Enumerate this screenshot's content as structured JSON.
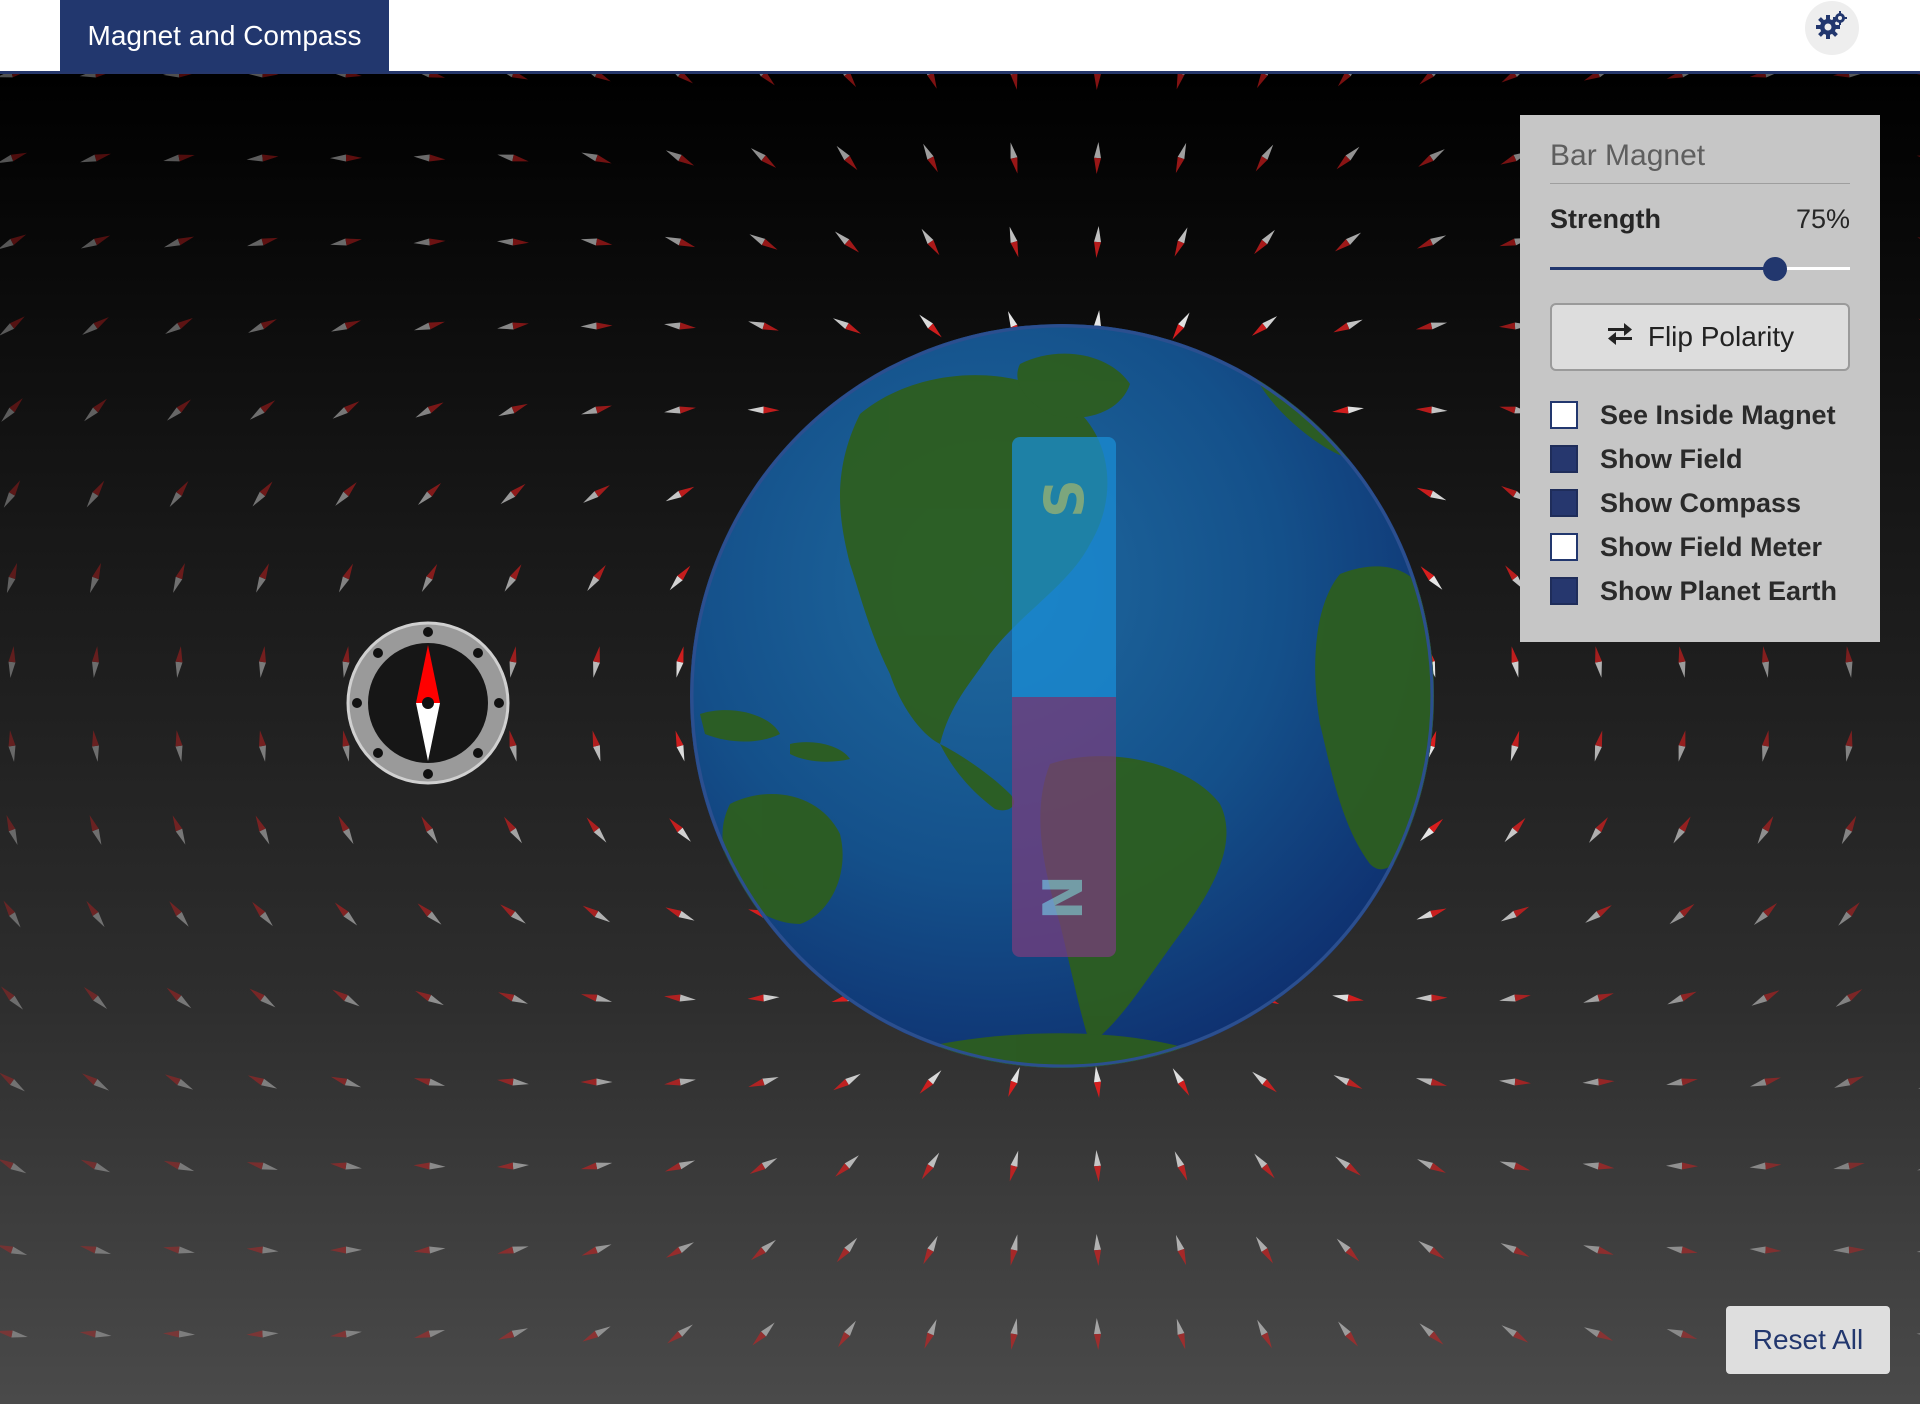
{
  "header": {
    "app_title": "Magnet and Compass",
    "settings_icon": "gears-icon"
  },
  "magnet": {
    "south_label": "S",
    "north_label": "N"
  },
  "panel": {
    "title": "Bar Magnet",
    "strength_label": "Strength",
    "strength_value_text": "75%",
    "strength_fraction": 0.75,
    "flip_label": "Flip Polarity",
    "flip_icon": "swap-arrows-icon",
    "checkboxes": [
      {
        "label": "See Inside Magnet",
        "checked": false
      },
      {
        "label": "Show Field",
        "checked": true
      },
      {
        "label": "Show Compass",
        "checked": true
      },
      {
        "label": "Show Field Meter",
        "checked": false
      },
      {
        "label": "Show Planet Earth",
        "checked": true
      }
    ]
  },
  "reset_label": "Reset All",
  "colors": {
    "accent": "#22376e",
    "needle_north": "#ff0000",
    "needle_south": "#ffffff"
  }
}
